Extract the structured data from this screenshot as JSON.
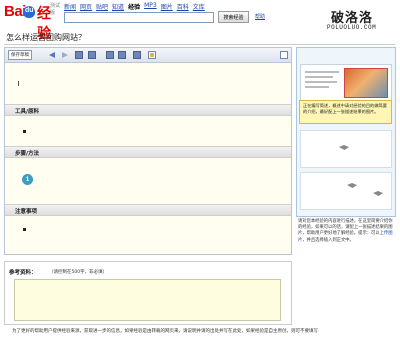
{
  "header": {
    "logo_text": "Baidu经验",
    "logo_paw": "du",
    "logo_beta": "测试版",
    "nav": [
      "新闻",
      "网页",
      "贴吧",
      "知道",
      "经验",
      "MP3",
      "图片",
      "百科",
      "文库"
    ],
    "active_nav": "经验",
    "search_placeholder": "",
    "search_button": "搜索经验",
    "help_link": "帮助"
  },
  "watermark": {
    "title": "破洛洛",
    "url": "POLUOLUO.COM"
  },
  "page_title": "怎么样运营团购网站？",
  "editor": {
    "save_draft": "保存草稿",
    "sections": [
      {
        "title": "工具/原料"
      },
      {
        "title": "步骤/方法"
      },
      {
        "title": "注意事项"
      }
    ],
    "step_number": "1"
  },
  "references": {
    "label": "参考资料：",
    "hint": "（请控制在500字，非必填）",
    "footer_note": "为了更好的帮助用户提供经验来源，获取进一步的信息，如果经验是由转载的网页来，请说明并请的出处并写在此处，如果经验是自主原创，则可不要填写"
  },
  "side_panel": {
    "callout": "正在编写简述，概述中请对经验的目的做简要的介绍，最好配上一张描述结果的图片。",
    "help_text_1": "请对您本经验的内容进行描述，在这里简要介绍你的经验，如果可以的话，请配上一张描述结果的图片，帮助用户更好地了解经验。提示：可以",
    "help_link": "上传图片",
    "help_text_2": "，并且选择插入到正文中。"
  },
  "colors": {
    "brand_red": "#e10602",
    "brand_blue": "#2d66d9",
    "link_blue": "#1a44b0",
    "editor_bg": "#fffef0",
    "callout_bg": "#fff5b4",
    "step_circle": "#3a9ec2"
  },
  "icons": [
    "undo-icon",
    "redo-icon",
    "bold-icon",
    "italic-icon",
    "ordered-list-icon",
    "unordered-list-icon",
    "link-icon",
    "image-icon",
    "expand-icon"
  ]
}
